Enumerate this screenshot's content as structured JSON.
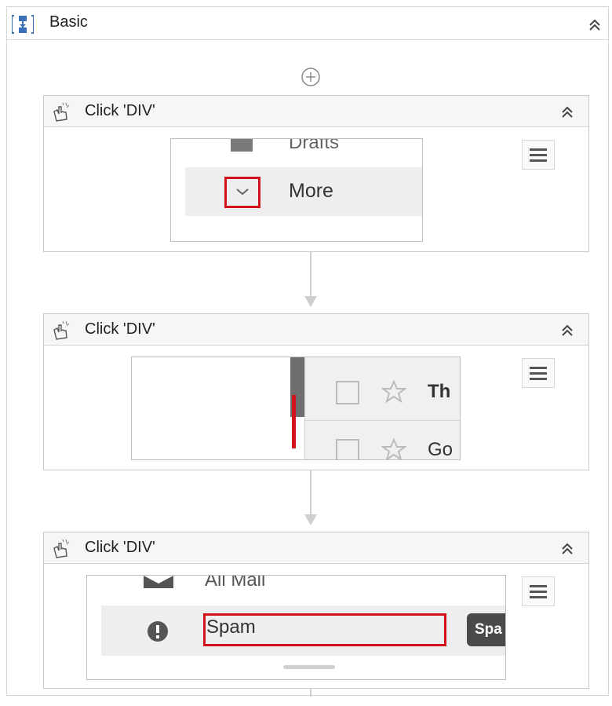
{
  "sequence": {
    "title": "Basic"
  },
  "activities": [
    {
      "title": "Click 'DIV'",
      "preview": {
        "row_top_label": "Drafts",
        "row_label": "More"
      }
    },
    {
      "title": "Click 'DIV'",
      "preview": {
        "row1_text": "Th",
        "row2_text": "Go"
      }
    },
    {
      "title": "Click 'DIV'",
      "preview": {
        "row_top_label": "All Mail",
        "row_label": "Spam",
        "chip_label": "Spa"
      }
    }
  ],
  "colors": {
    "highlight_red": "#d1121a",
    "header_bg": "#f6f6f6",
    "border": "#c9c9c9"
  }
}
